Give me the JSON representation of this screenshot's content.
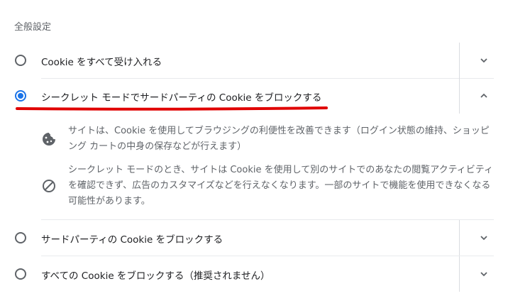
{
  "section_title": "全般設定",
  "options": [
    {
      "label": "Cookie をすべて受け入れる",
      "selected": false,
      "expanded": false
    },
    {
      "label": "シークレット モードでサードパーティの Cookie をブロックする",
      "selected": true,
      "expanded": true
    },
    {
      "label": "サードパーティの Cookie をブロックする",
      "selected": false,
      "expanded": false
    },
    {
      "label": "すべての Cookie をブロックする（推奨されません）",
      "selected": false,
      "expanded": false
    }
  ],
  "details": [
    {
      "icon": "cookie-icon",
      "text": "サイトは、Cookie を使用してブラウジングの利便性を改善できます（ログイン状態の維持、ショッピング カートの中身の保存などが行えます）"
    },
    {
      "icon": "block-icon",
      "text": "シークレット モードのとき、サイトは Cookie を使用して別のサイトでのあなたの閲覧アクティビティを確認できず、広告のカスタマイズなどを行えなくなります。一部のサイトで機能を使用できなくなる可能性があります。"
    }
  ],
  "colors": {
    "accent": "#1a73e8",
    "annotation": "#e00000"
  }
}
